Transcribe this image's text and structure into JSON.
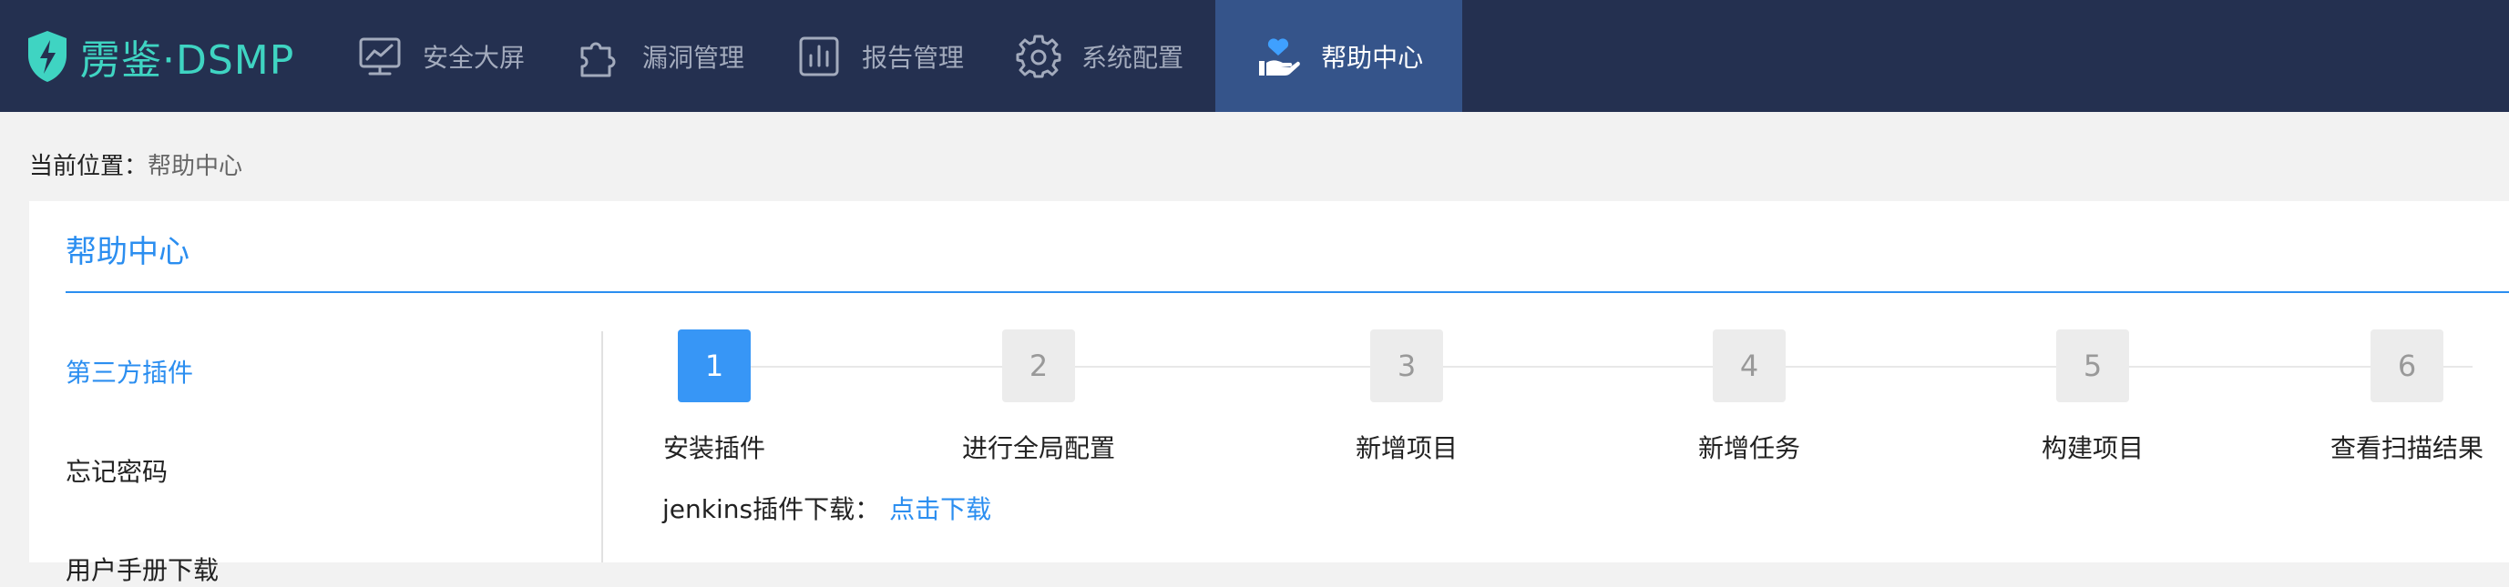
{
  "brand": {
    "name": "雳鉴·DSMP",
    "color": "#3fd4c2"
  },
  "nav": {
    "items": [
      {
        "label": "安全大屏",
        "icon": "monitor-chart-icon",
        "active": false
      },
      {
        "label": "漏洞管理",
        "icon": "puzzle-icon",
        "active": false
      },
      {
        "label": "报告管理",
        "icon": "bar-chart-icon",
        "active": false
      },
      {
        "label": "系统配置",
        "icon": "gear-icon",
        "active": false
      },
      {
        "label": "帮助中心",
        "icon": "help-hand-icon",
        "active": true
      }
    ]
  },
  "breadcrumb": {
    "label": "当前位置：",
    "value": "帮助中心"
  },
  "card": {
    "title": "帮助中心"
  },
  "sidemenu": {
    "items": [
      {
        "label": "第三方插件",
        "active": true
      },
      {
        "label": "忘记密码",
        "active": false
      },
      {
        "label": "用户手册下载",
        "active": false
      }
    ]
  },
  "steps": [
    {
      "num": "1",
      "label": "安装插件",
      "active": true
    },
    {
      "num": "2",
      "label": "进行全局配置",
      "active": false
    },
    {
      "num": "3",
      "label": "新增项目",
      "active": false
    },
    {
      "num": "4",
      "label": "新增任务",
      "active": false
    },
    {
      "num": "5",
      "label": "构建项目",
      "active": false
    },
    {
      "num": "6",
      "label": "查看扫描结果",
      "active": false
    }
  ],
  "download": {
    "label": "jenkins插件下载：",
    "link": "点击下载"
  },
  "colors": {
    "topbar": "#243050",
    "nav_active": "#35548a",
    "accent": "#2b8ef0",
    "step_active": "#3796f6"
  }
}
